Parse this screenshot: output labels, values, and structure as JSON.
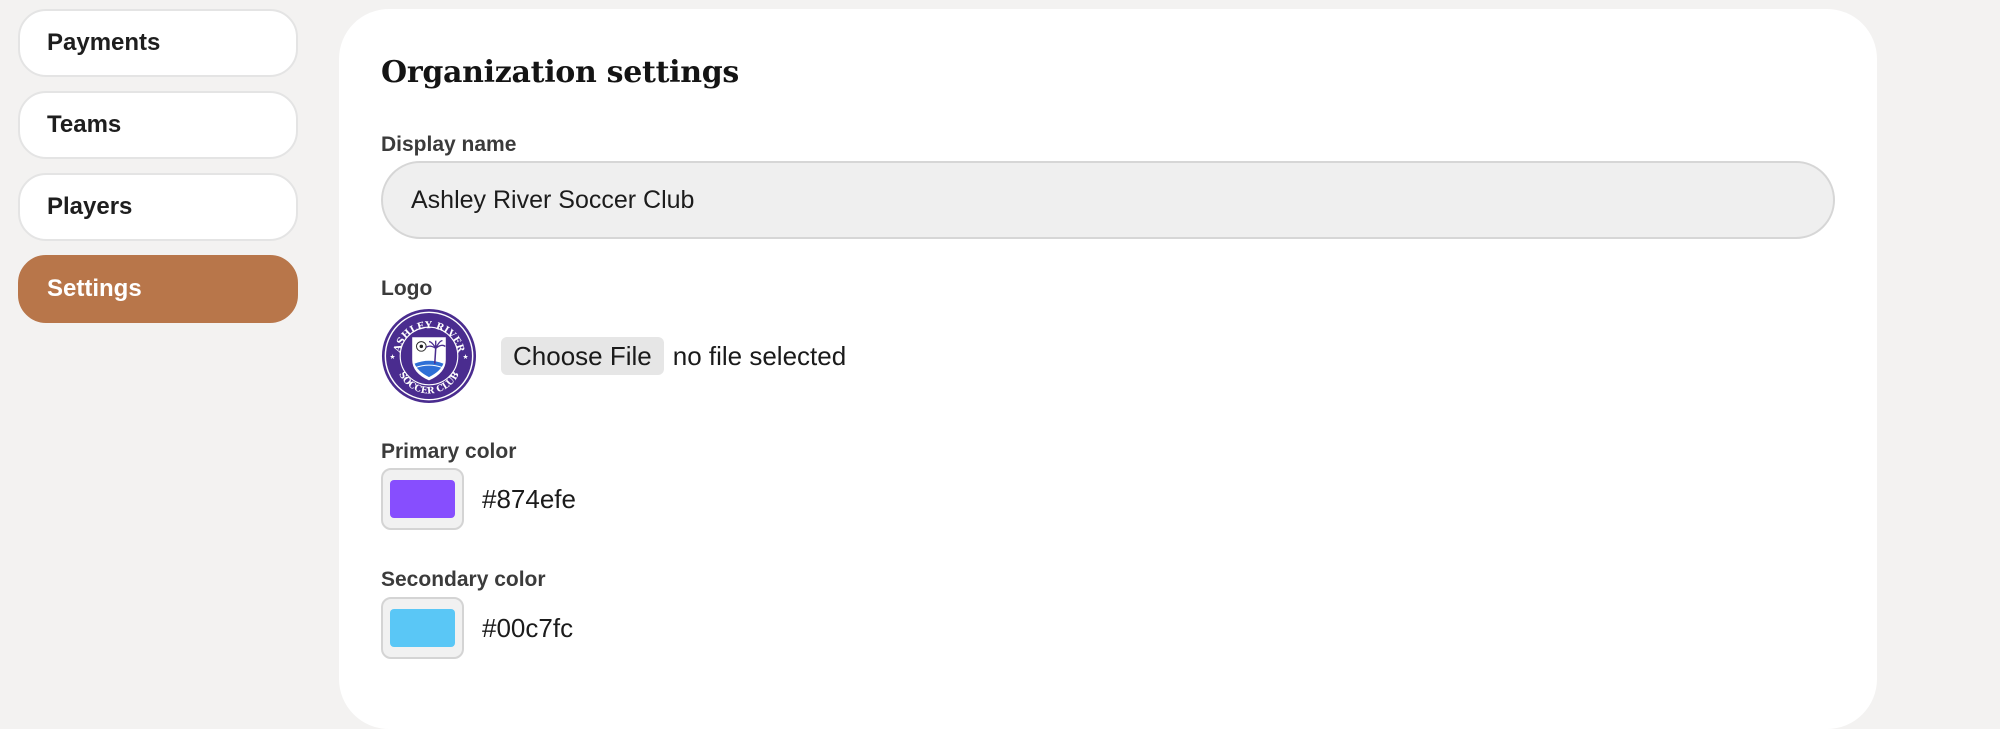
{
  "sidebar": {
    "items": [
      {
        "label": "Payments",
        "active": false
      },
      {
        "label": "Teams",
        "active": false
      },
      {
        "label": "Players",
        "active": false
      },
      {
        "label": "Settings",
        "active": true
      }
    ]
  },
  "settings": {
    "title": "Organization settings",
    "display_name": {
      "label": "Display name",
      "value": "Ashley River Soccer Club"
    },
    "logo": {
      "label": "Logo",
      "logo_text_top": "ASHLEY RIVER",
      "logo_text_bottom": "SOCCER CLUB",
      "button_label": "Choose File",
      "status": "no file selected"
    },
    "primary_color": {
      "label": "Primary color",
      "value": "#874efe"
    },
    "secondary_color": {
      "label": "Secondary color",
      "value": "#00c7fc"
    }
  },
  "colors": {
    "accent": "#b8764a",
    "logo_purple": "#4a2c8f"
  }
}
